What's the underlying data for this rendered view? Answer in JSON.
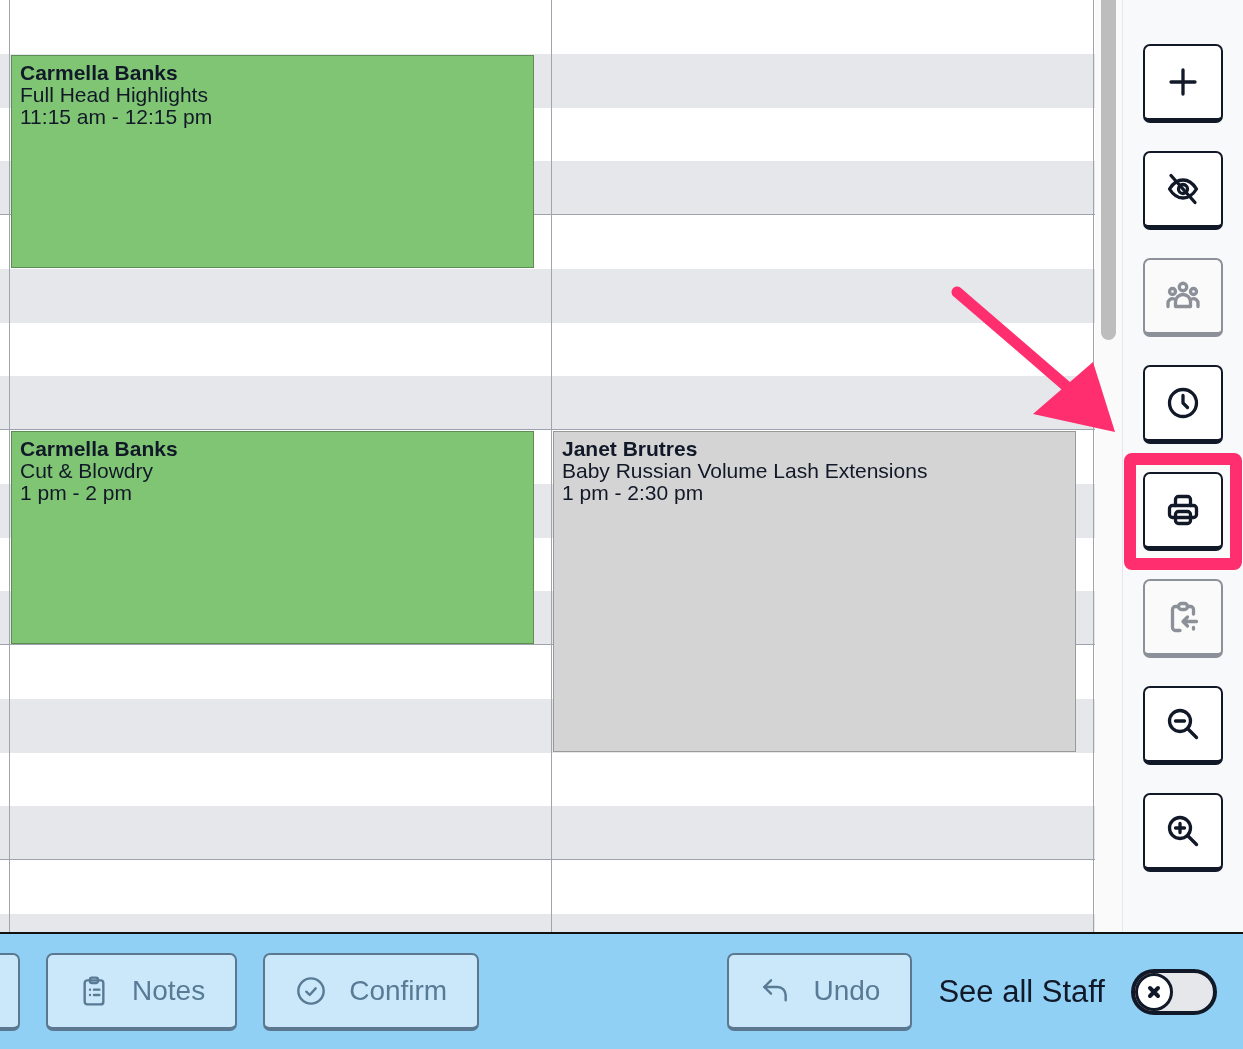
{
  "calendar": {
    "columns": [
      {
        "events": [
          {
            "client": "Carmella Banks",
            "service": "Full Head Highlights",
            "time": "11:15 am - 12:15 pm",
            "color": "#80c574"
          },
          {
            "client": "Carmella Banks",
            "service": "Cut & Blowdry",
            "time": "1 pm - 2 pm",
            "color": "#80c574"
          }
        ]
      },
      {
        "events": [
          {
            "client": "Janet Brutres",
            "service": "Baby Russian Volume Lash Extensions",
            "time": "1 pm - 2:30 pm",
            "color": "#d4d4d4"
          }
        ]
      }
    ]
  },
  "toolbar": {
    "buttons": [
      {
        "kind": "add",
        "disabled": false,
        "highlighted": false
      },
      {
        "kind": "hide",
        "disabled": false,
        "highlighted": false
      },
      {
        "kind": "group",
        "disabled": true,
        "highlighted": false
      },
      {
        "kind": "clock",
        "disabled": false,
        "highlighted": false
      },
      {
        "kind": "print",
        "disabled": false,
        "highlighted": true
      },
      {
        "kind": "paste",
        "disabled": true,
        "highlighted": false
      },
      {
        "kind": "zoom_out",
        "disabled": false,
        "highlighted": false
      },
      {
        "kind": "zoom_in",
        "disabled": false,
        "highlighted": false
      }
    ]
  },
  "bottom_bar": {
    "buttons": [
      {
        "label": "Notes",
        "kind": "notes"
      },
      {
        "label": "Confirm",
        "kind": "confirm"
      },
      {
        "label": "Undo",
        "kind": "undo"
      }
    ],
    "toggle": {
      "label": "See all Staff",
      "on": false
    }
  }
}
